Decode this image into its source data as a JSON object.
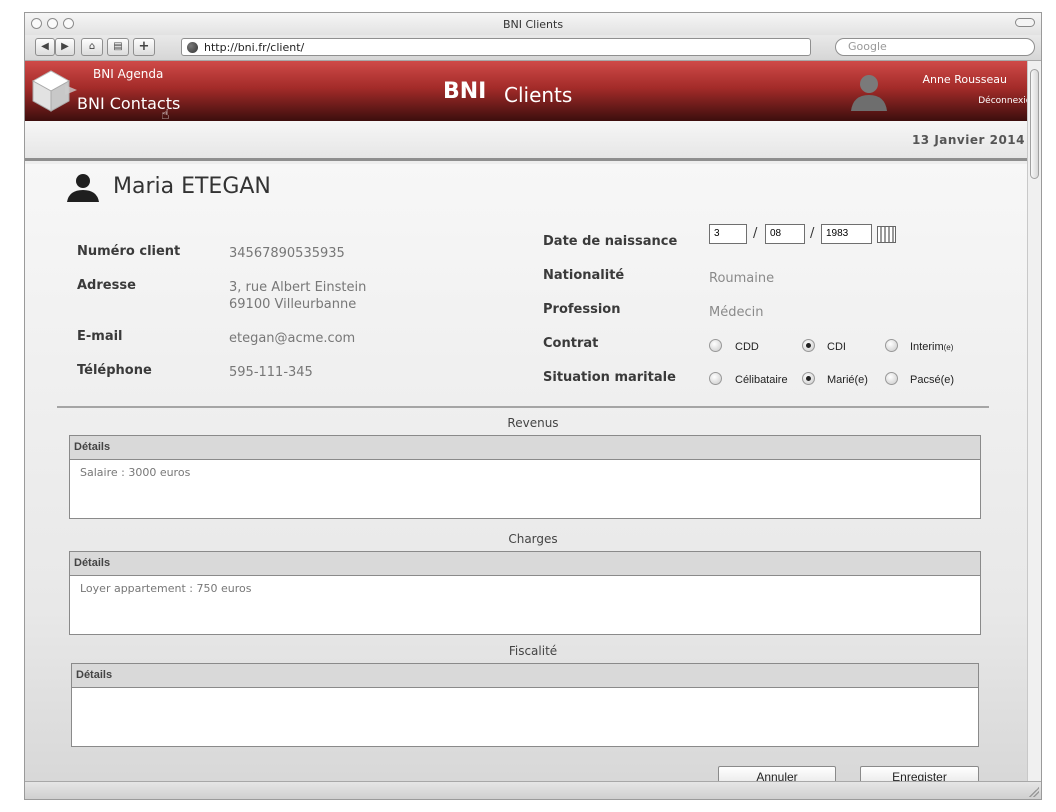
{
  "window": {
    "title": "BNI Clients"
  },
  "browser": {
    "url": "http://bni.fr/client/",
    "search_placeholder": "Google"
  },
  "header": {
    "nav_agenda": "BNI Agenda",
    "nav_contacts": "BNI Contacts",
    "brand": "BNI",
    "brand_sub": "Clients",
    "user_name": "Anne Rousseau",
    "logout": "Déconnexion"
  },
  "date": "13 Janvier 2014",
  "client": {
    "name": "Maria ETEGAN",
    "left_fields": [
      {
        "label": "Numéro client",
        "value": "34567890535935"
      },
      {
        "label": "Adresse",
        "value_line1": "3, rue Albert Einstein",
        "value_line2": "69100 Villeurbanne"
      },
      {
        "label": "E-mail",
        "value": "etegan@acme.com"
      },
      {
        "label": "Téléphone",
        "value": "595-111-345"
      }
    ],
    "birth": {
      "label": "Date de naissance",
      "day": "3",
      "month": "08",
      "year": "1983",
      "separator": "/"
    },
    "nationality": {
      "label": "Nationalité",
      "value": "Roumaine"
    },
    "profession": {
      "label": "Profession",
      "value": "Médecin"
    },
    "contract": {
      "label": "Contrat",
      "options": [
        "CDD",
        "CDI",
        "Interim"
      ],
      "interim_suffix": "(e)",
      "selected": "CDI"
    },
    "marital": {
      "label": "Situation maritale",
      "options": [
        "Célibataire",
        "Marié(e)",
        "Pacsé(e)"
      ],
      "selected": "Marié(e)"
    }
  },
  "sections": [
    {
      "title": "Revenus",
      "header": "Détails",
      "text": "Salaire : 3000 euros"
    },
    {
      "title": "Charges",
      "header": "Détails",
      "text": "Loyer appartement : 750 euros"
    },
    {
      "title": "Fiscalité",
      "header": "Détails",
      "text": ""
    }
  ],
  "buttons": {
    "cancel": "Annuler",
    "save": "Enregister"
  },
  "colors": {
    "header_top": "#cf4a48",
    "header_bottom": "#3c0e0d"
  }
}
